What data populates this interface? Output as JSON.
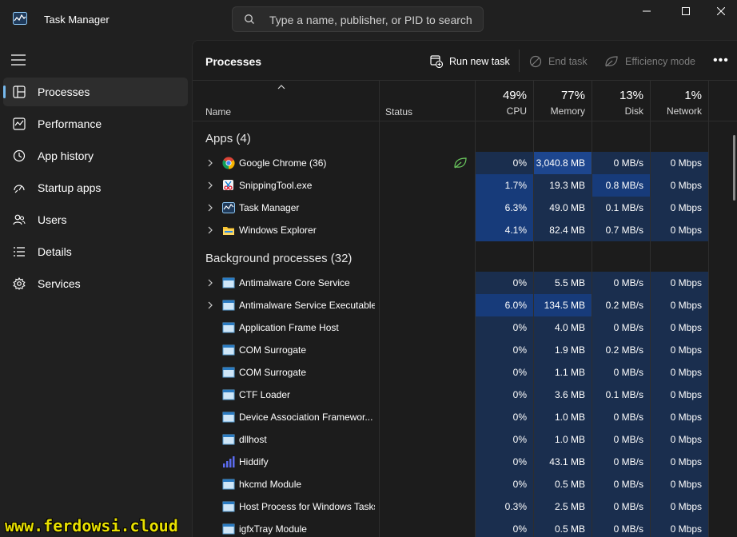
{
  "app": {
    "title": "Task Manager"
  },
  "search": {
    "placeholder": "Type a name, publisher, or PID to search"
  },
  "sidebar": {
    "items": [
      {
        "label": "Processes",
        "icon": "processes-grid-icon",
        "active": true
      },
      {
        "label": "Performance",
        "icon": "performance-chart-icon",
        "active": false
      },
      {
        "label": "App history",
        "icon": "history-clock-icon",
        "active": false
      },
      {
        "label": "Startup apps",
        "icon": "startup-gauge-icon",
        "active": false
      },
      {
        "label": "Users",
        "icon": "users-icon",
        "active": false
      },
      {
        "label": "Details",
        "icon": "details-list-icon",
        "active": false
      },
      {
        "label": "Services",
        "icon": "services-gear-icon",
        "active": false
      }
    ]
  },
  "toolbar": {
    "title": "Processes",
    "run_new_task": "Run new task",
    "end_task": "End task",
    "efficiency_mode": "Efficiency mode",
    "more": "•••"
  },
  "columns": {
    "name": "Name",
    "status": "Status",
    "cpu": {
      "pct": "49%",
      "label": "CPU"
    },
    "memory": {
      "pct": "77%",
      "label": "Memory"
    },
    "disk": {
      "pct": "13%",
      "label": "Disk"
    },
    "network": {
      "pct": "1%",
      "label": "Network"
    }
  },
  "groups": {
    "apps": "Apps (4)",
    "background": "Background processes (32)"
  },
  "apps": [
    {
      "name": "Google Chrome (36)",
      "icon": "chrome-icon",
      "expandable": true,
      "efficiency": true,
      "cpu": "0%",
      "memory": "3,040.8 MB",
      "disk": "0 MB/s",
      "network": "0 Mbps"
    },
    {
      "name": "SnippingTool.exe",
      "icon": "snipping-tool-icon",
      "expandable": true,
      "efficiency": false,
      "cpu": "1.7%",
      "memory": "19.3 MB",
      "disk": "0.8 MB/s",
      "network": "0 Mbps"
    },
    {
      "name": "Task Manager",
      "icon": "task-manager-icon",
      "expandable": true,
      "efficiency": false,
      "cpu": "6.3%",
      "memory": "49.0 MB",
      "disk": "0.1 MB/s",
      "network": "0 Mbps"
    },
    {
      "name": "Windows Explorer",
      "icon": "folder-icon",
      "expandable": true,
      "efficiency": false,
      "cpu": "4.1%",
      "memory": "82.4 MB",
      "disk": "0.7 MB/s",
      "network": "0 Mbps"
    }
  ],
  "background": [
    {
      "name": "Antimalware Core Service",
      "icon": "service-window-icon",
      "expandable": true,
      "cpu": "0%",
      "memory": "5.5 MB",
      "disk": "0 MB/s",
      "network": "0 Mbps"
    },
    {
      "name": "Antimalware Service Executable",
      "icon": "service-window-icon",
      "expandable": true,
      "cpu": "6.0%",
      "memory": "134.5 MB",
      "disk": "0.2 MB/s",
      "network": "0 Mbps"
    },
    {
      "name": "Application Frame Host",
      "icon": "service-window-icon",
      "expandable": false,
      "cpu": "0%",
      "memory": "4.0 MB",
      "disk": "0 MB/s",
      "network": "0 Mbps"
    },
    {
      "name": "COM Surrogate",
      "icon": "service-window-icon",
      "expandable": false,
      "cpu": "0%",
      "memory": "1.9 MB",
      "disk": "0.2 MB/s",
      "network": "0 Mbps"
    },
    {
      "name": "COM Surrogate",
      "icon": "service-window-icon",
      "expandable": false,
      "cpu": "0%",
      "memory": "1.1 MB",
      "disk": "0 MB/s",
      "network": "0 Mbps"
    },
    {
      "name": "CTF Loader",
      "icon": "service-window-icon",
      "expandable": false,
      "cpu": "0%",
      "memory": "3.6 MB",
      "disk": "0.1 MB/s",
      "network": "0 Mbps"
    },
    {
      "name": "Device Association Framewor...",
      "icon": "service-window-icon",
      "expandable": false,
      "cpu": "0%",
      "memory": "1.0 MB",
      "disk": "0 MB/s",
      "network": "0 Mbps"
    },
    {
      "name": "dllhost",
      "icon": "service-window-icon",
      "expandable": false,
      "cpu": "0%",
      "memory": "1.0 MB",
      "disk": "0 MB/s",
      "network": "0 Mbps"
    },
    {
      "name": "Hiddify",
      "icon": "hiddify-bars-icon",
      "expandable": false,
      "cpu": "0%",
      "memory": "43.1 MB",
      "disk": "0 MB/s",
      "network": "0 Mbps"
    },
    {
      "name": "hkcmd Module",
      "icon": "service-window-icon",
      "expandable": false,
      "cpu": "0%",
      "memory": "0.5 MB",
      "disk": "0 MB/s",
      "network": "0 Mbps"
    },
    {
      "name": "Host Process for Windows Tasks",
      "icon": "service-window-icon",
      "expandable": false,
      "cpu": "0.3%",
      "memory": "2.5 MB",
      "disk": "0 MB/s",
      "network": "0 Mbps"
    },
    {
      "name": "igfxTray Module",
      "icon": "service-window-icon",
      "expandable": false,
      "cpu": "0%",
      "memory": "0.5 MB",
      "disk": "0 MB/s",
      "network": "0 Mbps"
    }
  ],
  "watermark": "www.ferdowsi.cloud",
  "colors": {
    "accent": "#76b9ed",
    "heat_light": "#1a2e4e",
    "heat_medium": "#173b7a",
    "heat_strong": "#1d468e"
  }
}
